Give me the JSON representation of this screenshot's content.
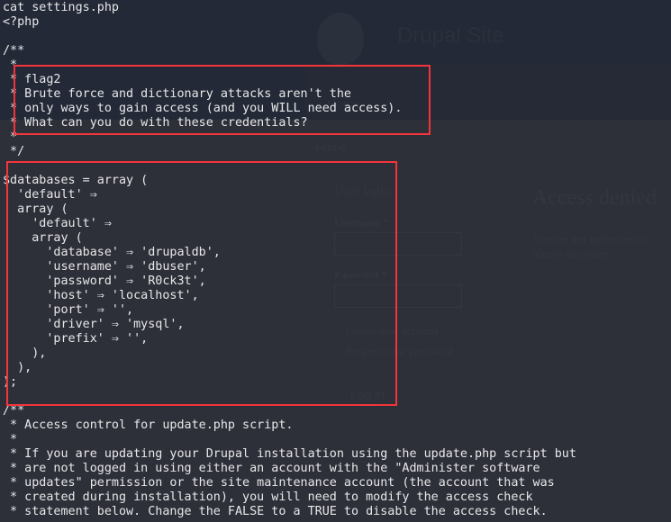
{
  "background_site": {
    "site_name": "Drupal Site",
    "nav_home": "Home",
    "breadcrumb_home": "Home",
    "login_block_title": "User login",
    "username_label": "Username *",
    "password_label": "Password *",
    "links": [
      "Create new account",
      "Request new password"
    ],
    "login_button": "Log in",
    "page_title": "Access denied",
    "message": "You are not authorized to access this page."
  },
  "terminal": {
    "lines": [
      "cat settings.php",
      "<?php",
      "",
      "/**",
      " *",
      " * flag2",
      " * Brute force and dictionary attacks aren't the",
      " * only ways to gain access (and you WILL need access).",
      " * What can you do with these credentials?",
      " *",
      " */",
      "",
      "$databases = array (",
      "  'default' ⇒",
      "  array (",
      "    'default' ⇒",
      "    array (",
      "      'database' ⇒ 'drupaldb',",
      "      'username' ⇒ 'dbuser',",
      "      'password' ⇒ 'R0ck3t',",
      "      'host' ⇒ 'localhost',",
      "      'port' ⇒ '',",
      "      'driver' ⇒ 'mysql',",
      "      'prefix' ⇒ '',",
      "    ),",
      "  ),",
      ");",
      "",
      "/**",
      " * Access control for update.php script.",
      " *",
      " * If you are updating your Drupal installation using the update.php script but",
      " * are not logged in using either an account with the \"Administer software",
      " * updates\" permission or the site maintenance account (the account that was",
      " * created during installation), you will need to modify the access check",
      " * statement below. Change the FALSE to a TRUE to disable the access check."
    ]
  },
  "colors": {
    "highlight": "#f4343a",
    "text": "#e8e8ea"
  }
}
